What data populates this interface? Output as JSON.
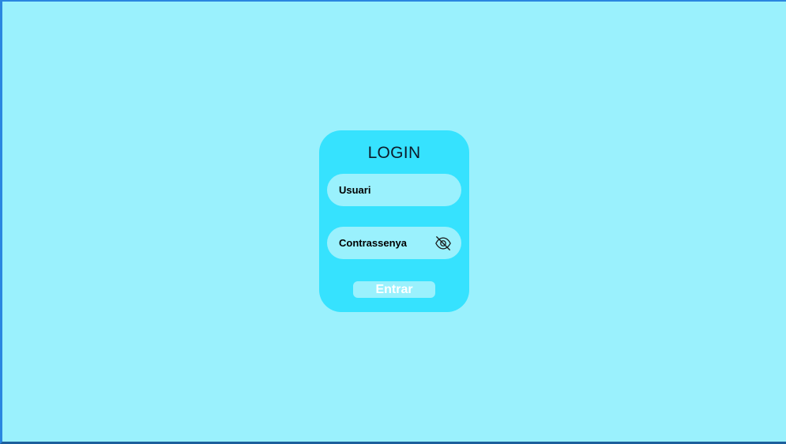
{
  "login": {
    "title": "LOGIN",
    "username_placeholder": "Usuari",
    "password_placeholder": "Contrassenya",
    "password_toggle_icon": "eye-off-icon",
    "submit_label": "Entrar"
  },
  "colors": {
    "background": "#9af1fd",
    "card": "#36e2fe",
    "field": "#9af1fd",
    "button_text": "#ffffff"
  }
}
